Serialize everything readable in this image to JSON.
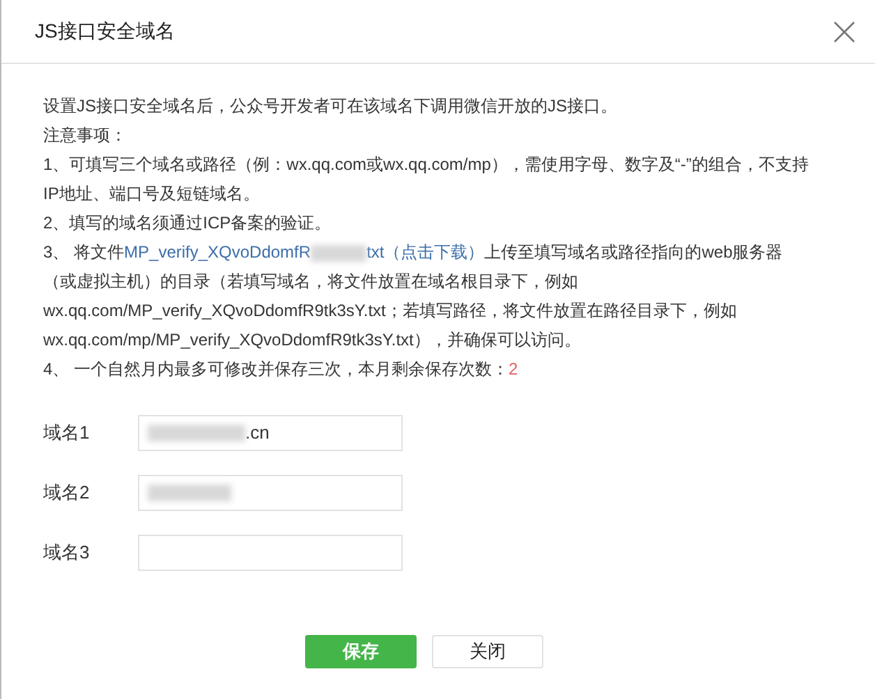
{
  "dialog": {
    "title": "JS接口安全域名"
  },
  "intro": "设置JS接口安全域名后，公众号开发者可在该域名下调用微信开放的JS接口。",
  "notes_heading": "注意事项：",
  "note_1": "1、可填写三个域名或路径（例：wx.qq.com或wx.qq.com/mp），需使用字母、数字及“-”的组合，不支持IP地址、端口号及短链域名。",
  "note_2": "2、填写的域名须通过ICP备案的验证。",
  "note_3": {
    "prefix": "3、 将文件",
    "link_start": "MP_verify_XQvoDdomfR",
    "link_end": "txt（点击下载）",
    "rest": "上传至填写域名或路径指向的web服务器（或虚拟主机）的目录（若填写域名，将文件放置在域名根目录下，例如wx.qq.com/MP_verify_XQvoDdomfR9tk3sY.txt；若填写路径，将文件放置在路径目录下，例如wx.qq.com/mp/MP_verify_XQvoDdomfR9tk3sY.txt），并确保可以访问。"
  },
  "note_4": {
    "text": "4、 一个自然月内最多可修改并保存三次，本月剩余保存次数：",
    "count": "2"
  },
  "fields": [
    {
      "label": "域名1",
      "value": ".cn",
      "redacted": true
    },
    {
      "label": "域名2",
      "redacted": true
    },
    {
      "label": "域名3",
      "redacted": false
    }
  ],
  "buttons": [
    {
      "label": "保存",
      "kind": "primary"
    },
    {
      "label": "关闭",
      "kind": "default"
    }
  ]
}
